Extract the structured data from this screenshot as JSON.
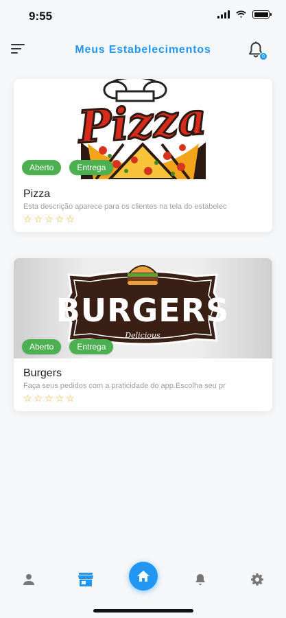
{
  "status_bar": {
    "time": "9:55"
  },
  "header": {
    "title": "Meus Estabelecimentos",
    "notification_badge": "0"
  },
  "establishments": [
    {
      "name": "Pizza",
      "logo_text": "Pizza",
      "description": "Esta descrição aparece para os clientes na tela do estabelec",
      "status_label": "Aberto",
      "delivery_label": "Entrega",
      "rating": 0,
      "stars": 5
    },
    {
      "name": "Burgers",
      "logo_text": "BURGERS",
      "logo_subtext": "Delicious",
      "description": "Faça seus pedidos com a praticidade do app.Escolha seu pr",
      "status_label": "Aberto",
      "delivery_label": "Entrega",
      "rating": 0,
      "stars": 5
    }
  ],
  "bottom_nav": {
    "items": [
      "person-icon",
      "store-icon",
      "home-icon",
      "bell-icon",
      "gear-icon"
    ],
    "active": "home-icon"
  },
  "colors": {
    "accent": "#2196f3",
    "badge_green": "#4caf50",
    "star": "#f5a623",
    "background": "#f6f7f9"
  }
}
